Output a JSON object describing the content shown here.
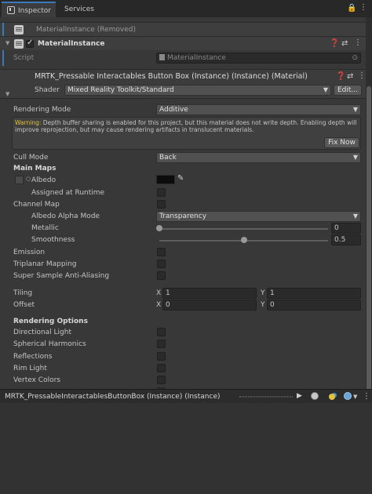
{
  "tabs": {
    "inspector": "Inspector",
    "services": "Services"
  },
  "removed_component": {
    "title": "MaterialInstance (Removed)"
  },
  "material_instance": {
    "title": "MaterialInstance",
    "script_label": "Script",
    "script_value": "MaterialInstance"
  },
  "material": {
    "title": "MRTK_Pressable Interactables Button Box (Instance) (Instance) (Material)",
    "shader_label": "Shader",
    "shader_value": "Mixed Reality Toolkit/Standard",
    "edit_button": "Edit..."
  },
  "rendering_mode": {
    "label": "Rendering Mode",
    "value": "Additive"
  },
  "warning": {
    "prefix": "Warning:",
    "text": " Depth buffer sharing is enabled for this project, but this material does not write depth. Enabling depth will improve reprojection, but may cause rendering artifacts in translucent materials.",
    "fix_button": "Fix Now"
  },
  "cull_mode": {
    "label": "Cull Mode",
    "value": "Back"
  },
  "main_maps": {
    "heading": "Main Maps",
    "albedo": "Albedo",
    "assigned_runtime": "Assigned at Runtime",
    "channel_map": "Channel Map",
    "albedo_alpha_mode_label": "Albedo Alpha Mode",
    "albedo_alpha_mode_value": "Transparency",
    "metallic_label": "Metallic",
    "metallic_value": "0",
    "metallic_level": 0,
    "smoothness_label": "Smoothness",
    "smoothness_value": "0.5",
    "smoothness_level": 0.5,
    "emission": "Emission",
    "triplanar": "Triplanar Mapping",
    "ssaa": "Super Sample Anti-Aliasing"
  },
  "tiling": {
    "label": "Tiling",
    "x_label": "X",
    "x": "1",
    "y_label": "Y",
    "y": "1"
  },
  "offset": {
    "label": "Offset",
    "x_label": "X",
    "x": "0",
    "y_label": "Y",
    "y": "0"
  },
  "rendering_options": {
    "heading": "Rendering Options",
    "directional_light": "Directional Light",
    "spherical_harmonics": "Spherical Harmonics",
    "reflections": "Reflections",
    "rim_light": "Rim Light",
    "vertex_colors": "Vertex Colors"
  },
  "preview": {
    "title": "MRTK_PressableInteractablesButtonBox (Instance) (Instance)"
  },
  "colors": {
    "accent": "#3a79bb",
    "warning": "#e3c33b",
    "background": "#383838"
  }
}
